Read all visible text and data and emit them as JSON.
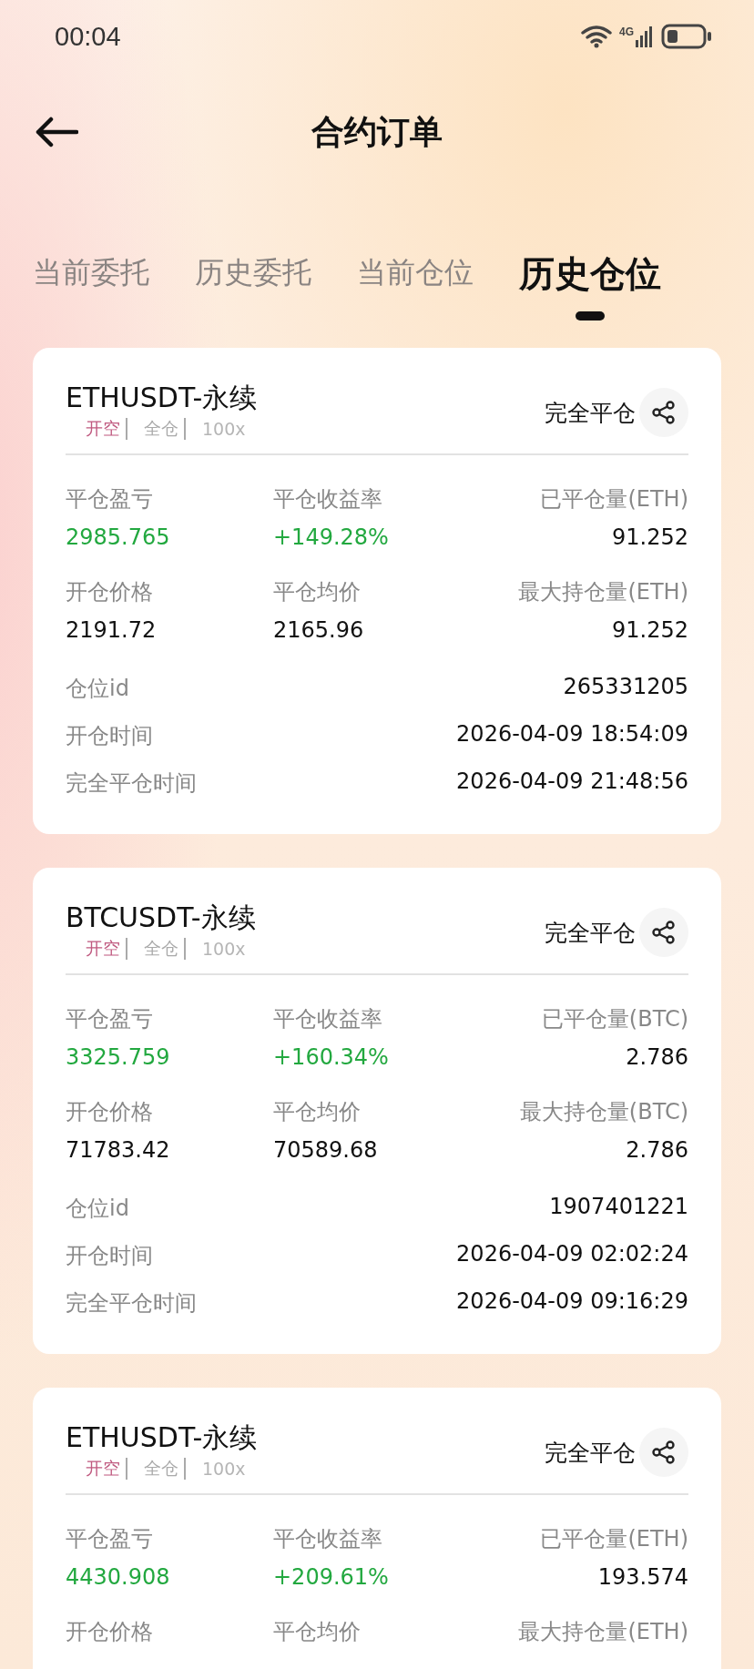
{
  "status_bar": {
    "time": "00:04",
    "network": "4G"
  },
  "header": {
    "title": "合约订单"
  },
  "tabs": [
    {
      "label": "当前委托",
      "selected": false
    },
    {
      "label": "历史委托",
      "selected": false
    },
    {
      "label": "当前仓位",
      "selected": false
    },
    {
      "label": "历史仓位",
      "selected": true
    }
  ],
  "positions": [
    {
      "symbol": "ETHUSDT-永续",
      "tags": [
        {
          "kind": "side",
          "text": "开空"
        },
        {
          "kind": "margin",
          "text": "全仓"
        },
        {
          "kind": "leverage",
          "text": "100x"
        }
      ],
      "action": "完全平仓",
      "stats": [
        [
          {
            "label": "平仓盈亏",
            "value": "2985.765",
            "kind": "gain"
          },
          {
            "label": "平仓收益率",
            "value": "+149.28%",
            "kind": "gain"
          },
          {
            "label": "已平仓量(ETH)",
            "value": "91.252",
            "kind": "plain"
          }
        ],
        [
          {
            "label": "开仓价格",
            "value": "2191.72",
            "kind": "plain"
          },
          {
            "label": "平仓均价",
            "value": "2165.96",
            "kind": "plain"
          },
          {
            "label": "最大持仓量(ETH)",
            "value": "91.252",
            "kind": "plain"
          }
        ]
      ],
      "details": [
        {
          "label": "仓位id",
          "value": "265331205"
        },
        {
          "label": "开仓时间",
          "value": "2026-04-09 18:54:09"
        },
        {
          "label": "完全平仓时间",
          "value": "2026-04-09 21:48:56"
        }
      ]
    },
    {
      "symbol": "BTCUSDT-永续",
      "tags": [
        {
          "kind": "side",
          "text": "开空"
        },
        {
          "kind": "margin",
          "text": "全仓"
        },
        {
          "kind": "leverage",
          "text": "100x"
        }
      ],
      "action": "完全平仓",
      "stats": [
        [
          {
            "label": "平仓盈亏",
            "value": "3325.759",
            "kind": "gain"
          },
          {
            "label": "平仓收益率",
            "value": "+160.34%",
            "kind": "gain"
          },
          {
            "label": "已平仓量(BTC)",
            "value": "2.786",
            "kind": "plain"
          }
        ],
        [
          {
            "label": "开仓价格",
            "value": "71783.42",
            "kind": "plain"
          },
          {
            "label": "平仓均价",
            "value": "70589.68",
            "kind": "plain"
          },
          {
            "label": "最大持仓量(BTC)",
            "value": "2.786",
            "kind": "plain"
          }
        ]
      ],
      "details": [
        {
          "label": "仓位id",
          "value": "1907401221"
        },
        {
          "label": "开仓时间",
          "value": "2026-04-09 02:02:24"
        },
        {
          "label": "完全平仓时间",
          "value": "2026-04-09 09:16:29"
        }
      ]
    },
    {
      "symbol": "ETHUSDT-永续",
      "tags": [
        {
          "kind": "side",
          "text": "开空"
        },
        {
          "kind": "margin",
          "text": "全仓"
        },
        {
          "kind": "leverage",
          "text": "100x"
        }
      ],
      "action": "完全平仓",
      "stats": [
        [
          {
            "label": "平仓盈亏",
            "value": "4430.908",
            "kind": "gain"
          },
          {
            "label": "平仓收益率",
            "value": "+209.61%",
            "kind": "gain"
          },
          {
            "label": "已平仓量(ETH)",
            "value": "193.574",
            "kind": "plain"
          }
        ],
        [
          {
            "label": "开仓价格"
          },
          {
            "label": "平仓均价"
          },
          {
            "label": "最大持仓量(ETH)"
          }
        ]
      ]
    }
  ]
}
